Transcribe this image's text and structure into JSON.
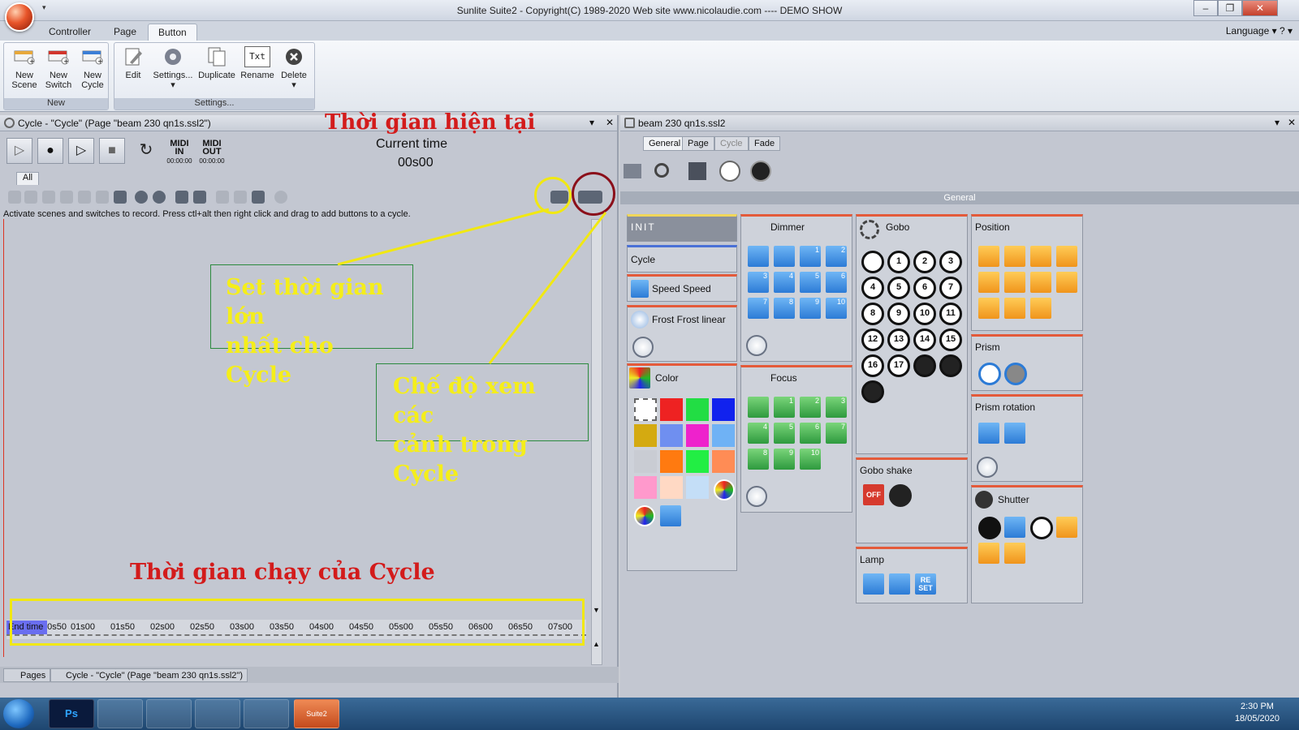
{
  "window": {
    "title": "Sunlite Suite2 - Copyright(C) 1989-2020   Web site www.nicolaudie.com ---- DEMO SHOW",
    "qat_arrow": "▾",
    "minimize": "–",
    "restore": "❐",
    "close": "✕"
  },
  "ribbon": {
    "tabs": [
      "Controller",
      "Page",
      "Button"
    ],
    "active_tab": "Button",
    "language": "Language ▾  ? ▾",
    "groups": {
      "new": {
        "label": "New",
        "buttons": [
          {
            "line1": "New",
            "line2": "Scene"
          },
          {
            "line1": "New",
            "line2": "Switch"
          },
          {
            "line1": "New",
            "line2": "Cycle"
          }
        ]
      },
      "settings": {
        "label": "Settings...",
        "buttons": [
          {
            "label": "Edit"
          },
          {
            "label": "Settings...",
            "arrow": "▾"
          },
          {
            "label": "Duplicate"
          },
          {
            "label": "Rename",
            "icon_text": "Txt"
          },
          {
            "label": "Delete",
            "arrow": "▾"
          }
        ]
      }
    }
  },
  "left_pane": {
    "header": "Cycle - \"Cycle\" (Page \"beam 230 qn1s.ssl2\")",
    "header_arrow": "▾",
    "header_close": "✕",
    "transport": {
      "play": "▷",
      "record": "●",
      "play_record": "▷",
      "stop": "■",
      "loop": "↻"
    },
    "midi_in": {
      "line1": "MIDI",
      "line2": "IN",
      "time": "00:00:00"
    },
    "midi_out": {
      "line1": "MIDI",
      "line2": "OUT",
      "time": "00:00:00"
    },
    "current_time_label": "Current time",
    "current_time_value": "00s00",
    "tab_all": "All",
    "hint": "Activate scenes and switches to record. Press ctl+alt then right click and drag to add buttons to a cycle.",
    "timeline": {
      "end_time": "End time",
      "ticks": [
        "00s50",
        "01s00",
        "01s50",
        "02s00",
        "02s50",
        "03s00",
        "03s50",
        "04s00",
        "04s50",
        "05s00",
        "05s50",
        "06s00",
        "06s50",
        "07s00"
      ]
    },
    "scroll_up": "▲",
    "scroll_down": "▼",
    "bottom_tabs": [
      "Pages",
      "Cycle - \"Cycle\" (Page \"beam 230 qn1s.ssl2\")"
    ]
  },
  "annotations": {
    "current_time": "Thời gian hiện tại",
    "max_time_line1": "Set thời gian lớn",
    "max_time_line2": "nhất cho Cycle",
    "view_mode_line1": "Chế độ xem các",
    "view_mode_line2": "cảnh trong Cycle",
    "run_time": "Thời gian chạy của Cycle"
  },
  "right_pane": {
    "header": "beam 230 qn1s.ssl2",
    "header_arrow": "▾",
    "header_close": "✕",
    "tabs": [
      "General",
      "Page",
      "Cycle",
      "Fade"
    ],
    "general_bar": "General",
    "panels": {
      "init": "INIT",
      "cycle": "Cycle",
      "speed": "Speed Speed",
      "frost": "Frost Frost linear",
      "color": "Color",
      "dimmer": "Dimmer",
      "focus": "Focus",
      "gobo": "Gobo",
      "gobo_shake": "Gobo shake",
      "lamp": "Lamp",
      "position": "Position",
      "prism": "Prism",
      "prism_rotation": "Prism rotation",
      "shutter": "Shutter"
    },
    "dimmer_numbers": [
      "",
      "",
      "1",
      "2",
      "3",
      "4",
      "5",
      "6",
      "7",
      "8",
      "9",
      "10"
    ],
    "focus_numbers": [
      "",
      "1",
      "2",
      "3",
      "4",
      "5",
      "6",
      "7",
      "8",
      "9",
      "10"
    ],
    "gobo_numbers": [
      "",
      "1",
      "2",
      "3",
      "4",
      "5",
      "6",
      "7",
      "8",
      "9",
      "10",
      "11",
      "12",
      "13",
      "14",
      "15",
      "16",
      "17"
    ],
    "color_swatches": [
      "#ffffff",
      "#ee2222",
      "#22dd44",
      "#1122ee",
      "#d4aa11",
      "#6f8ff0",
      "#ee22cc",
      "#6fb2f5",
      "#c9ccd3",
      "#ff7a10",
      "#22ee44",
      "#ff8c55",
      "#ff99cc",
      "#ffd9c4",
      "#c4def7"
    ],
    "lamp_reset": "RE SET",
    "gobo_shake_off": "OFF"
  },
  "taskbar": {
    "time": "2:30 PM",
    "date": "18/05/2020",
    "apps": [
      "Ps",
      "",
      "",
      "",
      "",
      "Suite2"
    ]
  }
}
